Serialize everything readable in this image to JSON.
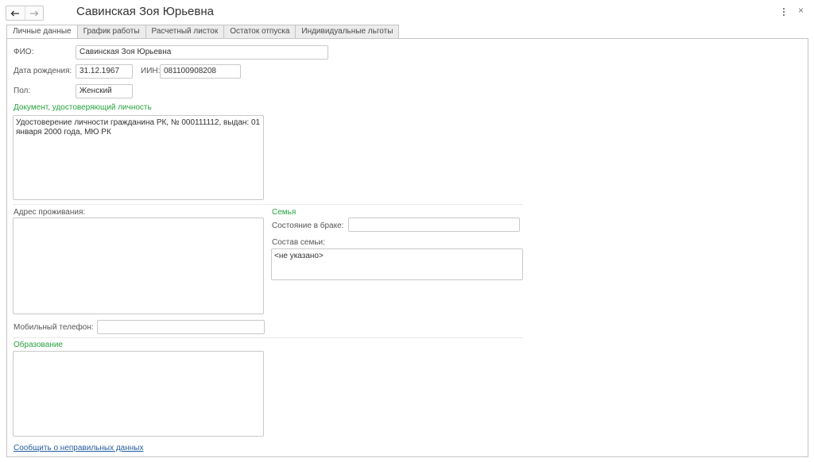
{
  "window": {
    "title": "Савинская Зоя Юрьевна",
    "back_icon": "arrow-left-icon",
    "forward_icon": "arrow-right-icon",
    "menu_icon": "more-vertical-icon",
    "close_icon": "close-icon",
    "close_glyph": "×"
  },
  "tabs": [
    {
      "label": "Личные данные",
      "active": true
    },
    {
      "label": "График работы",
      "active": false
    },
    {
      "label": "Расчетный листок",
      "active": false
    },
    {
      "label": "Остаток отпуска",
      "active": false
    },
    {
      "label": "Индивидуальные льготы",
      "active": false
    }
  ],
  "form": {
    "fio_label": "ФИО:",
    "fio_value": "Савинская Зоя Юрьевна",
    "birth_label": "Дата рождения:",
    "birth_value": "31.12.1967",
    "iin_label": "ИИН:",
    "iin_value": "081100908208",
    "gender_label": "Пол:",
    "gender_value": "Женский",
    "document_section": "Документ, удостоверяющий личность",
    "document_value": "Удостоверение личности гражданина РК, № 000111112, выдан: 01 января 2000 года, МЮ РК",
    "address_label": "Адрес проживания:",
    "address_value": "",
    "family_section": "Семья",
    "marital_label": "Состояние в браке:",
    "marital_value": "",
    "family_members_label": "Состав семьи:",
    "family_members_value": "<не указано>",
    "mobile_label": "Мобильный телефон:",
    "mobile_value": "",
    "education_section": "Образование",
    "education_value": "",
    "report_link": "Сообщить о неправильных данных"
  },
  "colors": {
    "section_header": "#27a33f",
    "link": "#245c9d",
    "border": "#c9c9c9"
  }
}
